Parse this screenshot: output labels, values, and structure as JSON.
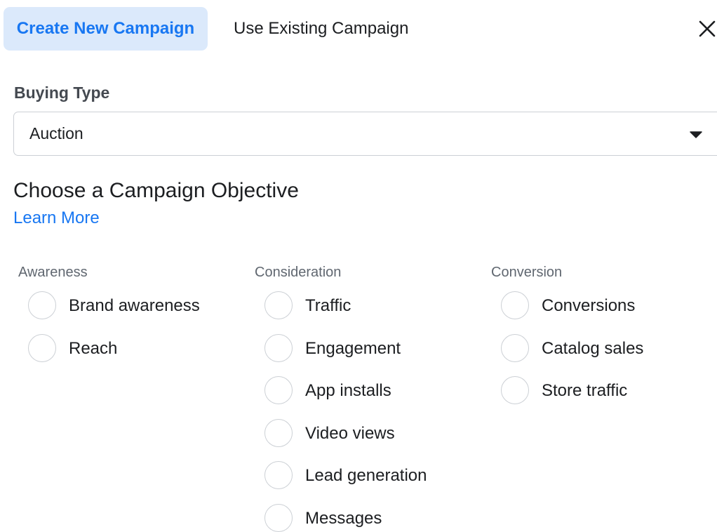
{
  "tabs": {
    "create_label": "Create New Campaign",
    "existing_label": "Use Existing Campaign"
  },
  "buying_type": {
    "label": "Buying Type",
    "value": "Auction"
  },
  "objective": {
    "title": "Choose a Campaign Objective",
    "learn_more": "Learn More",
    "columns": [
      {
        "header": "Awareness",
        "options": [
          "Brand awareness",
          "Reach"
        ]
      },
      {
        "header": "Consideration",
        "options": [
          "Traffic",
          "Engagement",
          "App installs",
          "Video views",
          "Lead generation",
          "Messages"
        ]
      },
      {
        "header": "Conversion",
        "options": [
          "Conversions",
          "Catalog sales",
          "Store traffic"
        ]
      }
    ]
  },
  "colors": {
    "accent": "#1877f2",
    "active_tab_bg": "#dbe9fb",
    "border": "#ccd0d5"
  },
  "icons": {
    "close": "close-icon",
    "dropdown": "caret-down-icon",
    "radio": "radio-unchecked-icon"
  }
}
